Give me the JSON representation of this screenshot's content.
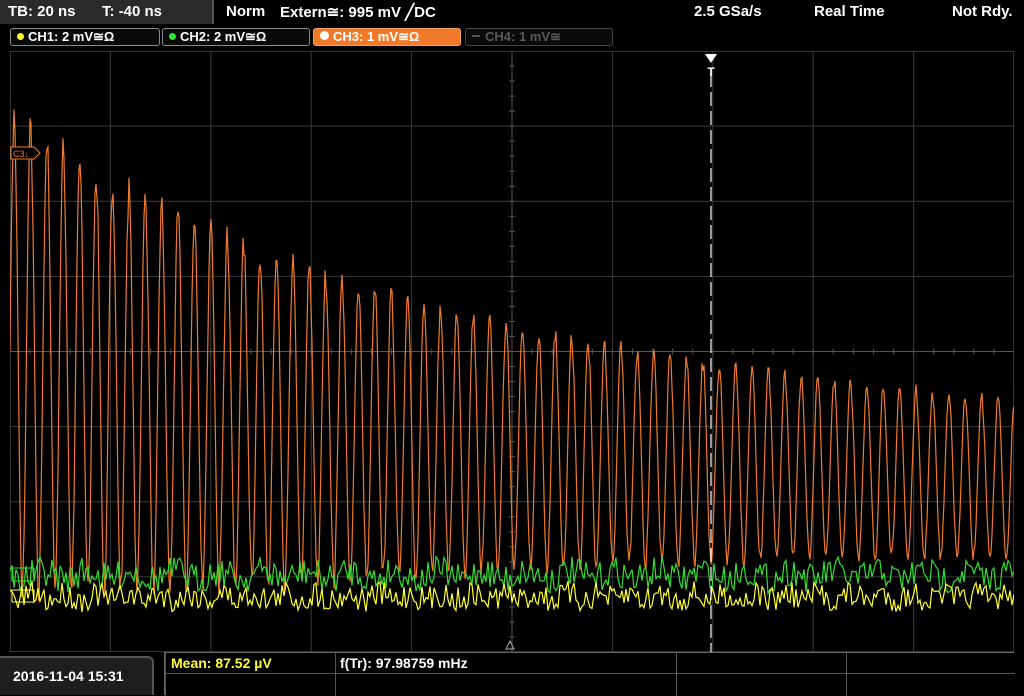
{
  "header": {
    "timebase": "TB: 20 ns",
    "trigger_time": "T: -40 ns",
    "mode": "Norm",
    "trigger_source": "Extern≅: 995 mV ╱DC",
    "sample_rate": "2.5 GSa/s",
    "acquisition": "Real Time",
    "status": "Not Rdy."
  },
  "channels": [
    {
      "label": "CH1: 2 mV≅Ω",
      "color": "#ffff33",
      "state": "on"
    },
    {
      "label": "CH2: 2 mV≅Ω",
      "color": "#33dd33",
      "state": "on"
    },
    {
      "label": "CH3: 1 mV≅Ω",
      "color": "#f07a2a",
      "state": "active"
    },
    {
      "label": "CH4: 1 mV≅",
      "color": "#555555",
      "state": "off"
    }
  ],
  "markers": {
    "ch3_level": "C3↓",
    "trigger_marker": "T"
  },
  "measurements": {
    "mean": "Mean: 87.52 µV",
    "freq": "f(Tr): 97.98759 mHz"
  },
  "footer": {
    "datetime": "2016-11-04 15:31"
  },
  "colors": {
    "ch1": "#ffff33",
    "ch2": "#33dd33",
    "ch3": "#f07a2a",
    "grid": "#3a3a3a"
  }
}
